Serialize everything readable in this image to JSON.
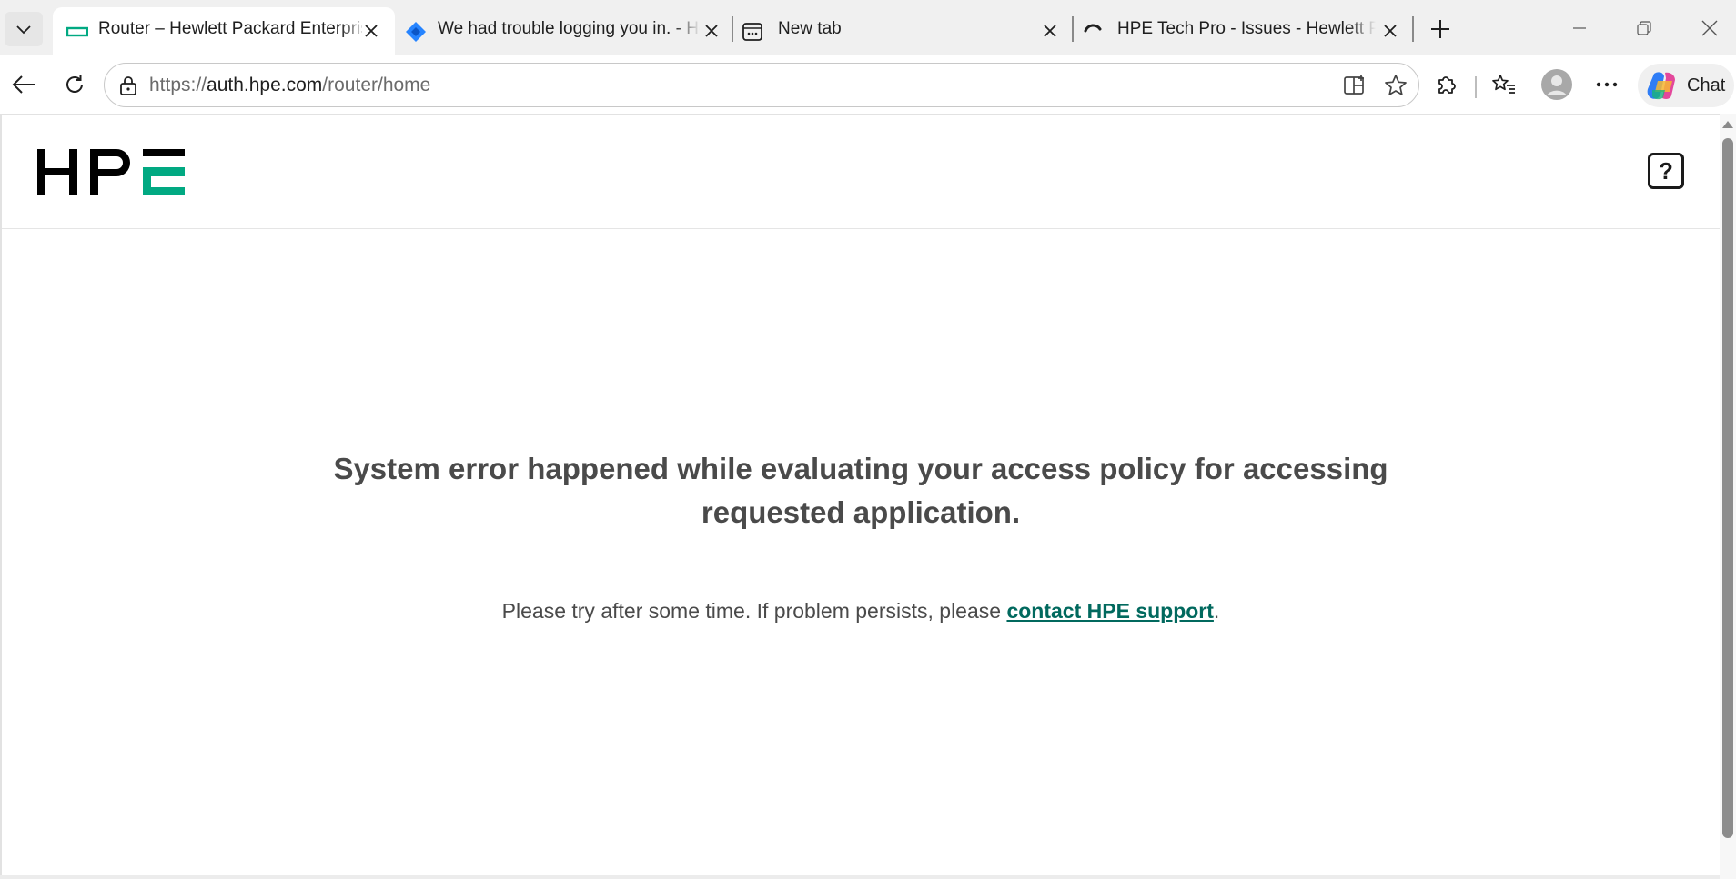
{
  "browser": {
    "tabs": [
      {
        "title": "Router – Hewlett Packard Enterprise",
        "favicon": "hpe-favicon",
        "active": true
      },
      {
        "title": "We had trouble logging you in. - Hewlett Packard Enterprise",
        "favicon": "diamond-favicon",
        "active": false
      },
      {
        "title": "New tab",
        "favicon": "newtab-favicon",
        "active": false
      },
      {
        "title": "HPE Tech Pro - Issues - Hewlett Packard Enterprise",
        "favicon": "loading-spinner",
        "active": false
      }
    ],
    "address": {
      "scheme": "https://",
      "host": "auth.hpe.com",
      "path": "/router/home"
    },
    "chat_label": "Chat"
  },
  "page": {
    "logo_text": "HPE",
    "help_glyph": "?",
    "error_title": "System error happened while evaluating your access policy for accessing requested application.",
    "message_prefix": "Please try after some time. If problem persists, please ",
    "message_link": "contact HPE support",
    "message_suffix": "."
  },
  "colors": {
    "brand_green": "#01a982",
    "link_green": "#01695e",
    "heading_gray": "#4a4a4a"
  }
}
